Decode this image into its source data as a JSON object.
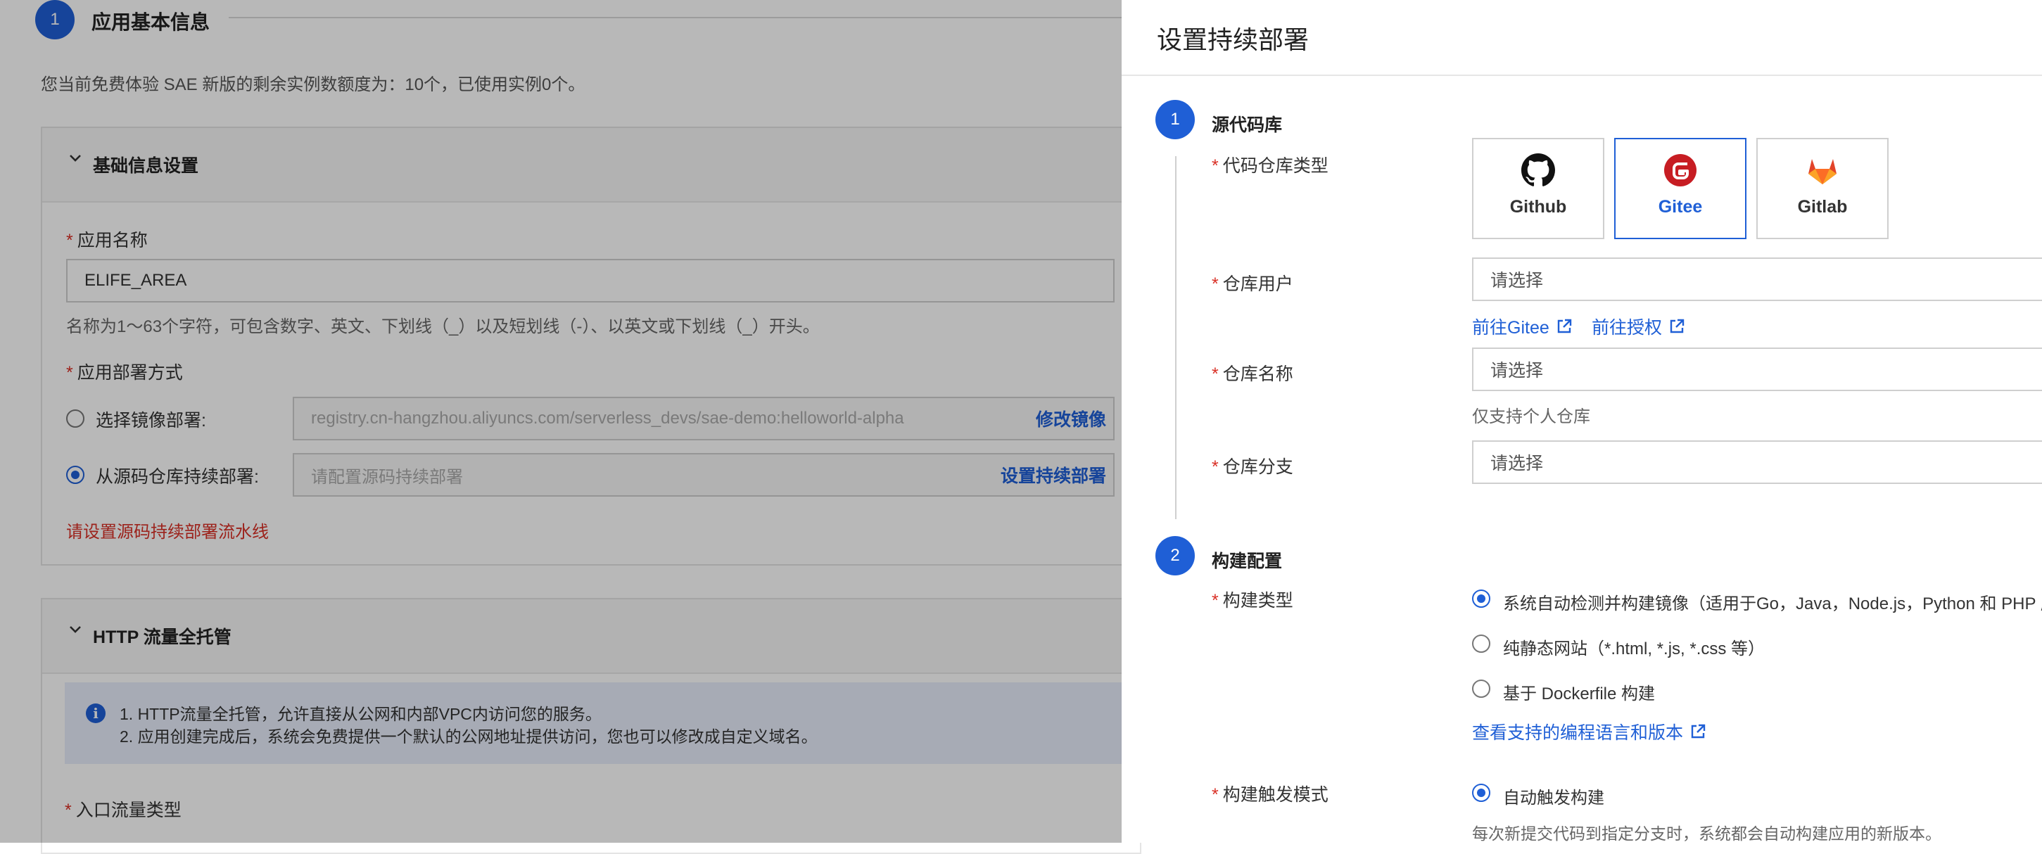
{
  "background": {
    "step_number": "1",
    "step_title": "应用基本信息",
    "quota_text": "您当前免费体验 SAE 新版的剩余实例数额度为：10个，已使用实例0个。",
    "basic_section": {
      "title": "基础信息设置",
      "app_name_label": "应用名称",
      "app_name_value": "ELIFE_AREA",
      "app_name_help": "名称为1～63个字符，可包含数字、英文、下划线（_）以及短划线（-）、以英文或下划线（_）开头。",
      "deploy_label": "应用部署方式",
      "image_option_label": "选择镜像部署:",
      "image_value": "registry.cn-hangzhou.aliyuncs.com/serverless_devs/sae-demo:helloworld-alpha",
      "image_action": "修改镜像",
      "source_option_label": "从源码仓库持续部署:",
      "source_placeholder": "请配置源码持续部署",
      "source_action": "设置持续部署",
      "error_text": "请设置源码持续部署流水线"
    },
    "http_section": {
      "title": "HTTP 流量全托管",
      "info_line1": "1. HTTP流量全托管，允许直接从公网和内部VPC内访问您的服务。",
      "info_line2": "2. 应用创建完成后，系统会免费提供一个默认的公网地址提供访问，您也可以修改成自定义域名。",
      "entry_label": "入口流量类型"
    }
  },
  "drawer": {
    "title": "设置持续部署",
    "step1": {
      "number": "1",
      "title": "源代码库",
      "repo_type_label": "代码仓库类型",
      "repo_types": [
        {
          "name": "Github"
        },
        {
          "name": "Gitee"
        },
        {
          "name": "Gitlab"
        }
      ],
      "repo_user_label": "仓库用户",
      "repo_user_placeholder": "请选择",
      "link_goto": "前往Gitee",
      "link_auth": "前往授权",
      "repo_name_label": "仓库名称",
      "repo_name_placeholder": "请选择",
      "repo_name_help": "仅支持个人仓库",
      "branch_label": "仓库分支",
      "branch_placeholder": "请选择"
    },
    "step2": {
      "number": "2",
      "title": "构建配置",
      "build_type_label": "构建类型",
      "build_options": [
        "系统自动检测并构建镜像（适用于Go，Java，Node.js，Python 和 PHP 应",
        "纯静态网站（*.html, *.js, *.css 等）",
        "基于 Dockerfile 构建"
      ],
      "supported_link": "查看支持的编程语言和版本",
      "trigger_label": "构建触发模式",
      "trigger_option": "自动触发构建",
      "trigger_help": "每次新提交代码到指定分支时，系统都会自动构建应用的新版本。"
    }
  },
  "colors": {
    "accent": "#1f5fd6",
    "required": "#d93026",
    "gitee": "#c71d23",
    "gitlab": "#e24329"
  }
}
